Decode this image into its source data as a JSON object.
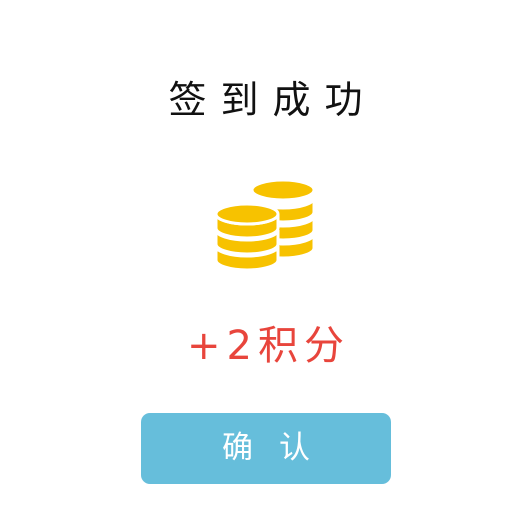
{
  "dialog": {
    "title": "签到成功",
    "reward_text": "+2积分",
    "confirm_label": "确认",
    "coin_icon": "coin-stack-icon"
  },
  "colors": {
    "title": "#111111",
    "reward": "#e8453c",
    "button": "#66bedb",
    "button_text": "#ffffff",
    "coin_gold": "#f7c200"
  }
}
